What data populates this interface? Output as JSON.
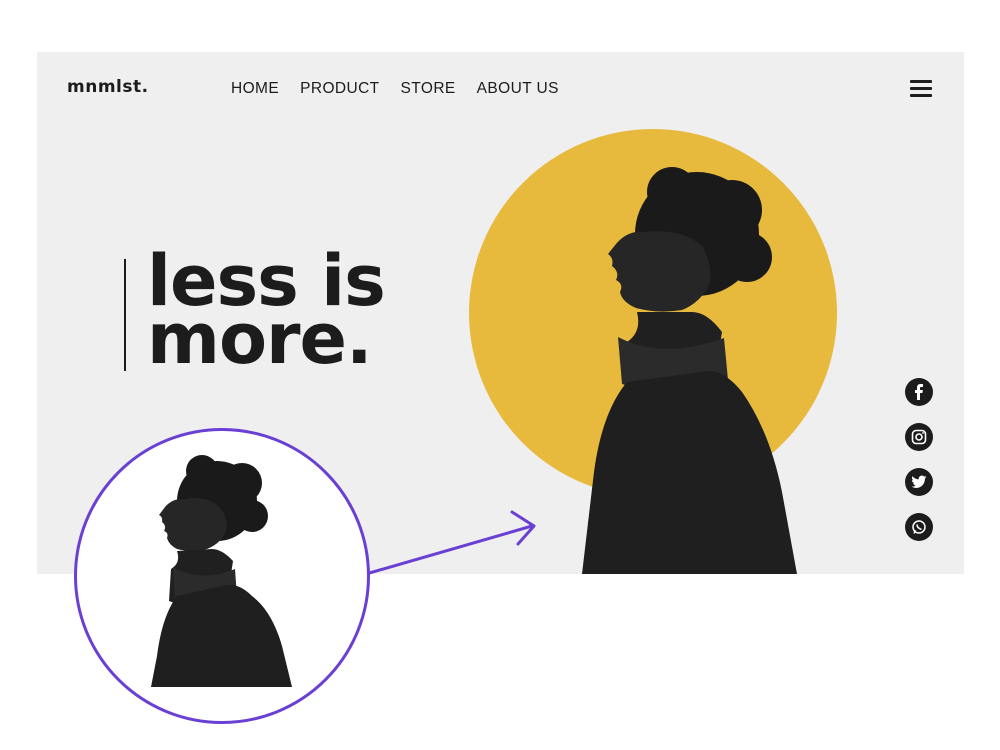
{
  "brand": {
    "logo_text": "mnmlst."
  },
  "nav": {
    "items": [
      {
        "label": "HOME"
      },
      {
        "label": "PRODUCT"
      },
      {
        "label": "STORE"
      },
      {
        "label": "ABOUT US"
      }
    ]
  },
  "hero": {
    "headline_line1": "less is",
    "headline_line2": "more.",
    "accent_color": "#e7b93c",
    "background_color": "#efefef"
  },
  "social": {
    "icons": [
      "facebook-icon",
      "instagram-icon",
      "twitter-icon",
      "whatsapp-icon"
    ]
  },
  "annotation": {
    "zoom_border_color": "#6a3fd3",
    "arrow_color": "#6a3fd3"
  }
}
